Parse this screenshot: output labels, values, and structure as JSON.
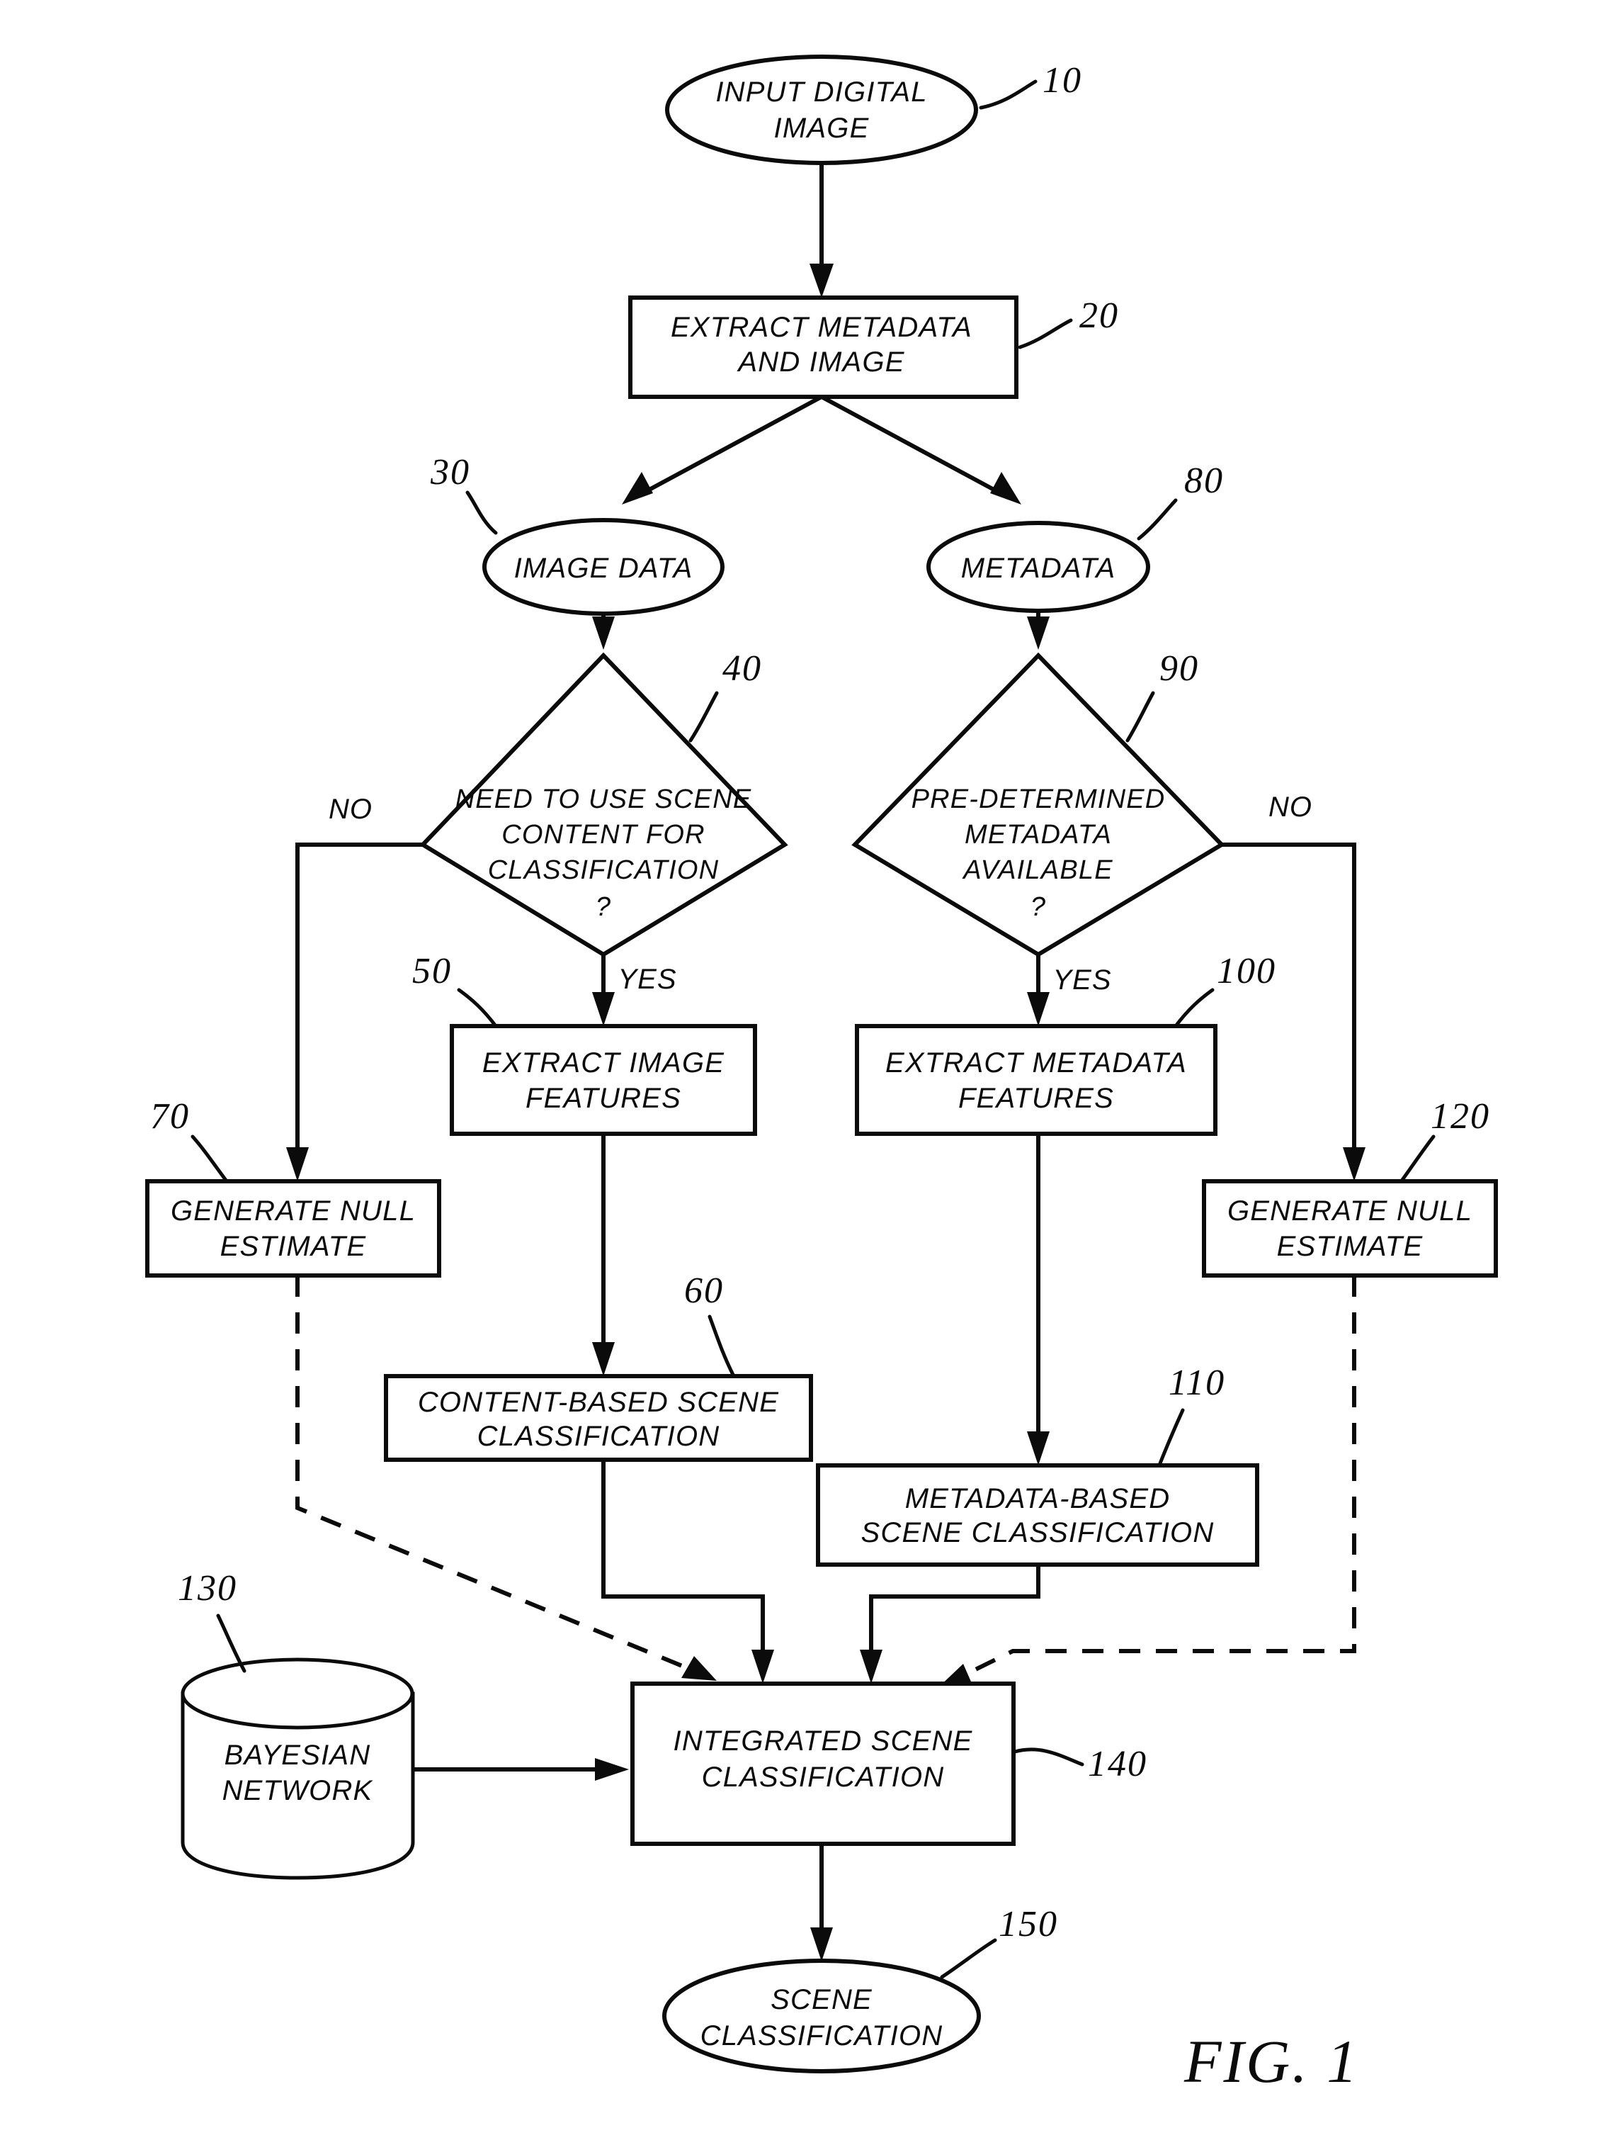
{
  "figure": {
    "caption": "FIG. 1",
    "title": "Scene classification flowchart combining image content and metadata"
  },
  "nodes": [
    {
      "id": "n10",
      "ref": "10",
      "shape": "ellipse",
      "lines": [
        "INPUT DIGITAL",
        "IMAGE"
      ]
    },
    {
      "id": "n20",
      "ref": "20",
      "shape": "rectangle",
      "lines": [
        "EXTRACT METADATA",
        "AND IMAGE"
      ]
    },
    {
      "id": "n30",
      "ref": "30",
      "shape": "ellipse",
      "lines": [
        "IMAGE  DATA"
      ]
    },
    {
      "id": "n80",
      "ref": "80",
      "shape": "ellipse",
      "lines": [
        "METADATA"
      ]
    },
    {
      "id": "n40",
      "ref": "40",
      "shape": "diamond",
      "lines": [
        "NEED TO USE SCENE",
        "CONTENT FOR",
        "CLASSIFICATION",
        "?"
      ]
    },
    {
      "id": "n90",
      "ref": "90",
      "shape": "diamond",
      "lines": [
        "PRE-DETERMINED",
        "METADATA",
        "AVAILABLE",
        "?"
      ]
    },
    {
      "id": "n50",
      "ref": "50",
      "shape": "rectangle",
      "lines": [
        "EXTRACT IMAGE",
        "FEATURES"
      ]
    },
    {
      "id": "n100",
      "ref": "100",
      "shape": "rectangle",
      "lines": [
        "EXTRACT  METADATA",
        "FEATURES"
      ]
    },
    {
      "id": "n70",
      "ref": "70",
      "shape": "rectangle",
      "lines": [
        "GENERATE NULL",
        "ESTIMATE"
      ]
    },
    {
      "id": "n120",
      "ref": "120",
      "shape": "rectangle",
      "lines": [
        "GENERATE NULL",
        "ESTIMATE"
      ]
    },
    {
      "id": "n60",
      "ref": "60",
      "shape": "rectangle",
      "lines": [
        "CONTENT-BASED SCENE",
        "CLASSIFICATION"
      ]
    },
    {
      "id": "n110",
      "ref": "110",
      "shape": "rectangle",
      "lines": [
        "METADATA-BASED",
        "SCENE CLASSIFICATION"
      ]
    },
    {
      "id": "n130",
      "ref": "130",
      "shape": "cylinder",
      "lines": [
        "BAYESIAN",
        "NETWORK"
      ]
    },
    {
      "id": "n140",
      "ref": "140",
      "shape": "rectangle",
      "lines": [
        "INTEGRATED SCENE",
        "CLASSIFICATION"
      ]
    },
    {
      "id": "n150",
      "ref": "150",
      "shape": "ellipse",
      "lines": [
        "SCENE",
        "CLASSIFICATION"
      ]
    }
  ],
  "text": {
    "n10_l1": "INPUT DIGITAL",
    "n10_l2": "IMAGE",
    "n20_l1": "EXTRACT METADATA",
    "n20_l2": "AND IMAGE",
    "n30_l1": "IMAGE  DATA",
    "n80_l1": "METADATA",
    "n40_l1": "NEED TO USE SCENE",
    "n40_l2": "CONTENT FOR",
    "n40_l3": "CLASSIFICATION",
    "n40_l4": "?",
    "n90_l1": "PRE-DETERMINED",
    "n90_l2": "METADATA",
    "n90_l3": "AVAILABLE",
    "n90_l4": "?",
    "n50_l1": "EXTRACT IMAGE",
    "n50_l2": "FEATURES",
    "n100_l1": "EXTRACT  METADATA",
    "n100_l2": "FEATURES",
    "n70_l1": "GENERATE NULL",
    "n70_l2": "ESTIMATE",
    "n120_l1": "GENERATE NULL",
    "n120_l2": "ESTIMATE",
    "n60_l1": "CONTENT-BASED SCENE",
    "n60_l2": "CLASSIFICATION",
    "n110_l1": "METADATA-BASED",
    "n110_l2": "SCENE CLASSIFICATION",
    "n130_l1": "BAYESIAN",
    "n130_l2": "NETWORK",
    "n140_l1": "INTEGRATED SCENE",
    "n140_l2": "CLASSIFICATION",
    "n150_l1": "SCENE",
    "n150_l2": "CLASSIFICATION"
  },
  "refs": {
    "r10": "10",
    "r20": "20",
    "r30": "30",
    "r80": "80",
    "r40": "40",
    "r90": "90",
    "r50": "50",
    "r100": "100",
    "r70": "70",
    "r120": "120",
    "r60": "60",
    "r110": "110",
    "r130": "130",
    "r140": "140",
    "r150": "150"
  },
  "edge_labels": {
    "no_left": "NO",
    "yes_left": "YES",
    "no_right": "NO",
    "yes_right": "YES"
  },
  "colors": {
    "ink": "#0b0b0b",
    "paper": "#ffffff"
  }
}
